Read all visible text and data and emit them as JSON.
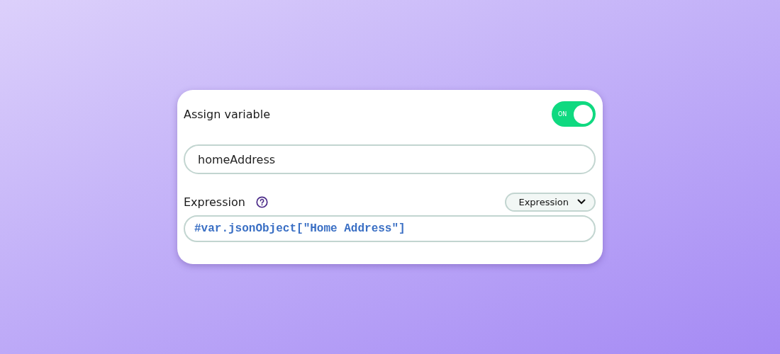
{
  "card": {
    "title": "Assign variable",
    "toggle": {
      "label": "ON",
      "on": true
    },
    "variable_field": {
      "value": "homeAddress"
    },
    "expression": {
      "label": "Expression",
      "mode_dropdown": {
        "value": "Expression"
      },
      "value": "#var.jsonObject[\"Home Address\"]"
    }
  }
}
